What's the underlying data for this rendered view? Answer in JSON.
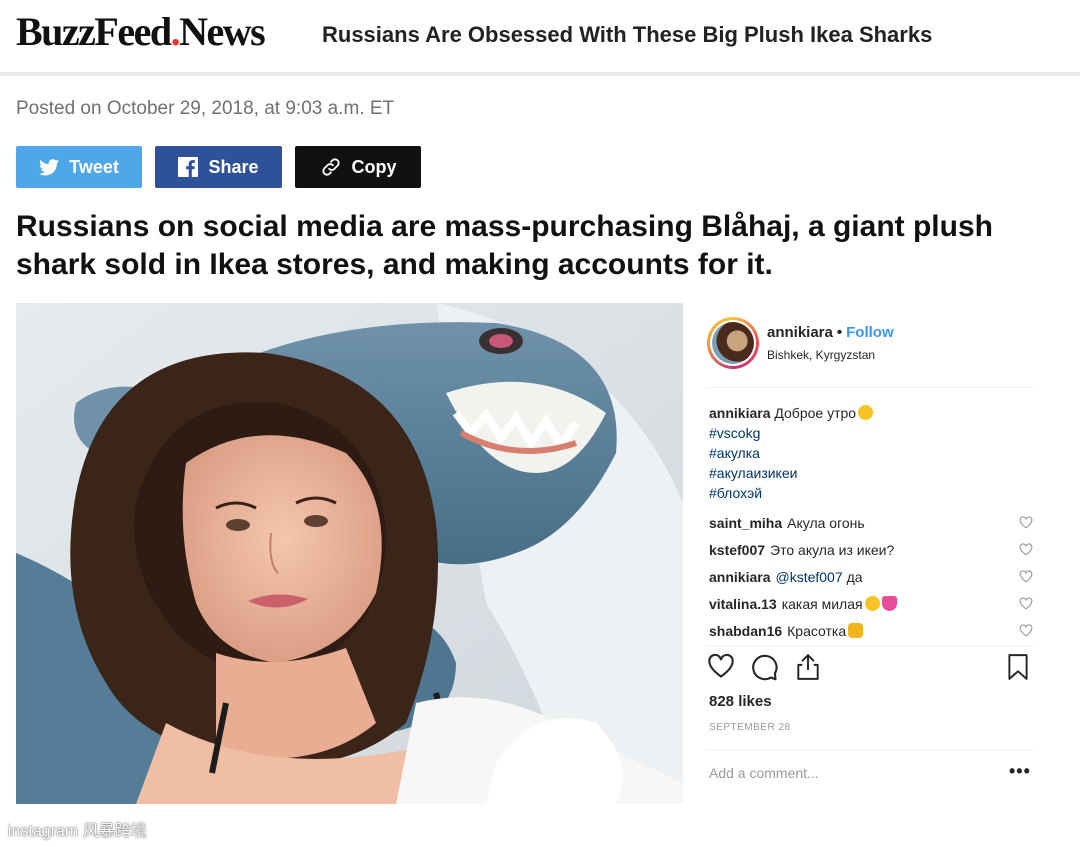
{
  "header": {
    "logo_part1": "BuzzFeed",
    "logo_dot": ".",
    "logo_part2": "News",
    "title": "Russians Are Obsessed With These Big Plush Ikea Sharks"
  },
  "meta": {
    "posted": "Posted on October 29, 2018, at 9:03 a.m. ET"
  },
  "share": {
    "tweet": "Tweet",
    "share": "Share",
    "copy": "Copy"
  },
  "headline": "Russians on social media are mass-purchasing Blåhaj, a giant plush shark sold in Ikea stores, and making accounts for it.",
  "instagram": {
    "username": "annikiara",
    "separator": "•",
    "follow": "Follow",
    "location": "Bishkek, Kyrgyzstan",
    "caption_user": "annikiara",
    "caption_text": "Доброе утро",
    "hashtags": [
      "#vscokg",
      "#акулка",
      "#акулаизикеи",
      "#блохэй"
    ],
    "comments": [
      {
        "user": "saint_miha",
        "mention": "",
        "text": "Акула огонь",
        "emoji": ""
      },
      {
        "user": "kstef007",
        "mention": "",
        "text": "Это акула из икеи?",
        "emoji": ""
      },
      {
        "user": "annikiara",
        "mention": "@kstef007",
        "text": "да",
        "emoji": ""
      },
      {
        "user": "vitalina.13",
        "mention": "",
        "text": "какая милая",
        "emoji": "smile-heart"
      },
      {
        "user": "shabdan16",
        "mention": "",
        "text": "Красотка",
        "emoji": "thumb"
      }
    ],
    "likes": "828 likes",
    "date": "SEPTEMBER 28",
    "add_comment_placeholder": "Add a comment...",
    "more": "•••",
    "icons": [
      "heart-icon",
      "comment-icon",
      "share-icon",
      "bookmark-icon"
    ]
  },
  "watermark": {
    "left": "instagram",
    "cn": "风暴跨境"
  },
  "colors": {
    "tweet": "#4da7e8",
    "facebook": "#2f5199",
    "copy": "#111111",
    "logo_dot": "#ee3322",
    "ig_link": "#3897f0"
  }
}
